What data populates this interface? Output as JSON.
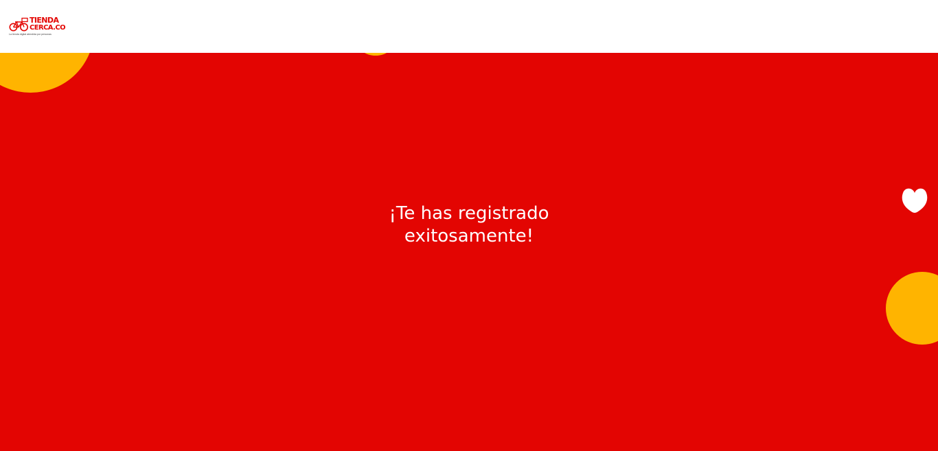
{
  "header": {
    "logo": {
      "line1": "TIENDA",
      "line2": "CERCA.CO",
      "tagline": "La tienda digital atendida por personas",
      "icon": "bicycle-icon"
    }
  },
  "hero": {
    "message_line1": "¡Te has registrado",
    "message_line2": "exitosamente!",
    "decorations": [
      "yellow-circle",
      "yellow-circle",
      "yellow-circle",
      "heart-icon"
    ]
  },
  "colors": {
    "brand_red": "#e30502",
    "accent_yellow": "#ffb400",
    "header_bg": "#ffffff",
    "text_on_red": "#ffffff"
  }
}
